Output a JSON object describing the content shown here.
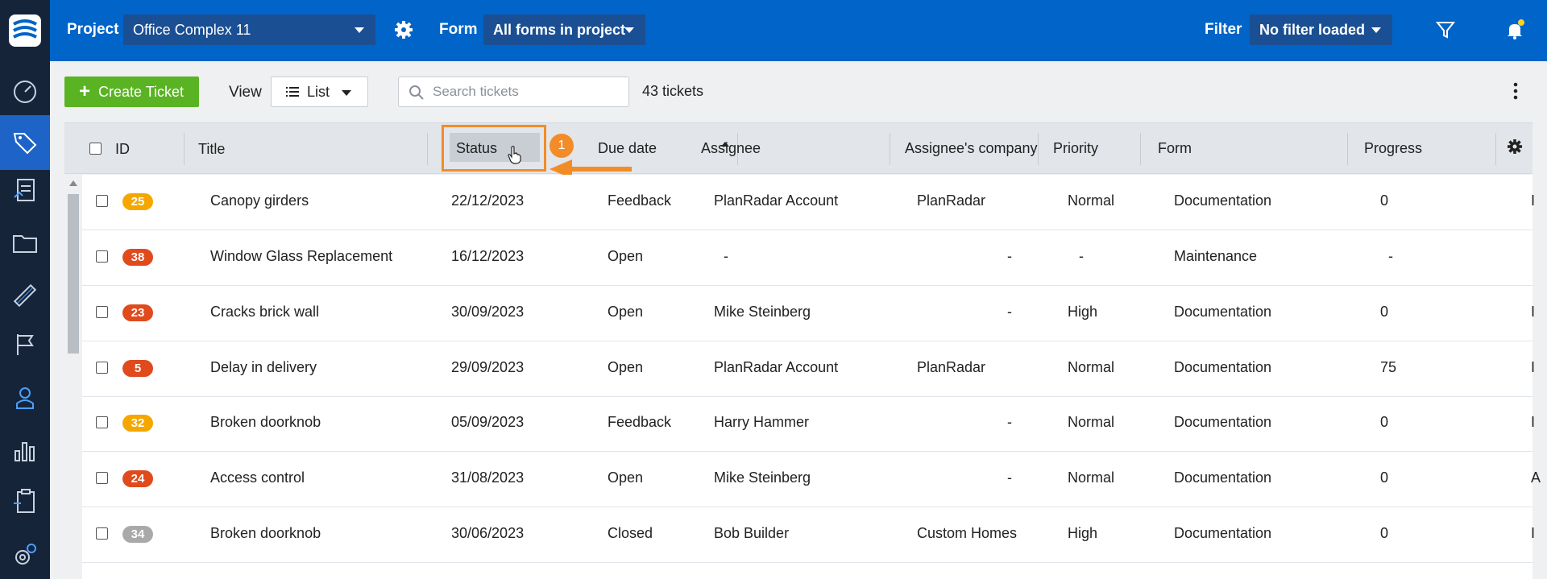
{
  "topbar": {
    "project_label": "Project",
    "project_value": "Office Complex 11",
    "form_label": "Form",
    "form_value": "All forms in project",
    "filter_label": "Filter",
    "filter_value": "No filter loaded"
  },
  "sidebar": {
    "items": [
      {
        "icon": "dashboard-icon"
      },
      {
        "icon": "tickets-icon",
        "active": true
      },
      {
        "icon": "forms-icon"
      },
      {
        "icon": "folder-icon"
      },
      {
        "icon": "plans-icon"
      },
      {
        "icon": "flag-icon"
      },
      {
        "icon": "user-icon"
      },
      {
        "icon": "reports-icon"
      },
      {
        "icon": "clipboard-icon"
      },
      {
        "icon": "settings-icon"
      }
    ]
  },
  "toolbar": {
    "create_label": "Create Ticket",
    "view_label": "View",
    "view_value": "List",
    "search_placeholder": "Search tickets",
    "ticket_count": "43 tickets"
  },
  "table": {
    "columns": [
      "ID",
      "Title",
      "Status",
      "Due date",
      "Assignee",
      "Assignee's company",
      "Priority",
      "Form",
      "Progress"
    ],
    "rows": [
      {
        "id": "25",
        "id_color": "#f5a700",
        "title": "Canopy girders",
        "due": "22/12/2023",
        "status": "Feedback",
        "assignee": "PlanRadar Account",
        "company": "PlanRadar",
        "priority": "Normal",
        "form": "Documentation",
        "progress": "0",
        "edge": "I"
      },
      {
        "id": "38",
        "id_color": "#e04a1c",
        "title": "Window Glass Replacement",
        "due": "16/12/2023",
        "status": "Open",
        "assignee": "-",
        "company": "-",
        "priority": "-",
        "form": "Maintenance",
        "progress": "-",
        "edge": ""
      },
      {
        "id": "23",
        "id_color": "#e04a1c",
        "title": "Cracks brick wall",
        "due": "30/09/2023",
        "status": "Open",
        "assignee": "Mike Steinberg",
        "company": "-",
        "priority": "High",
        "form": "Documentation",
        "progress": "0",
        "edge": "I"
      },
      {
        "id": "5",
        "id_color": "#e04a1c",
        "title": "Delay in delivery",
        "due": "29/09/2023",
        "status": "Open",
        "assignee": "PlanRadar Account",
        "company": "PlanRadar",
        "priority": "Normal",
        "form": "Documentation",
        "progress": "75",
        "edge": "I"
      },
      {
        "id": "32",
        "id_color": "#f5a700",
        "title": "Broken doorknob",
        "due": "05/09/2023",
        "status": "Feedback",
        "assignee": "Harry Hammer",
        "company": "-",
        "priority": "Normal",
        "form": "Documentation",
        "progress": "0",
        "edge": "I"
      },
      {
        "id": "24",
        "id_color": "#e04a1c",
        "title": "Access control",
        "due": "31/08/2023",
        "status": "Open",
        "assignee": "Mike Steinberg",
        "company": "-",
        "priority": "Normal",
        "form": "Documentation",
        "progress": "0",
        "edge": "A"
      },
      {
        "id": "34",
        "id_color": "#a9a9a9",
        "title": "Broken doorknob",
        "due": "30/06/2023",
        "status": "Closed",
        "assignee": "Bob Builder",
        "company": "Custom Homes",
        "priority": "High",
        "form": "Documentation",
        "progress": "0",
        "edge": "I"
      }
    ]
  },
  "annotation": {
    "step_number": "1",
    "color": "#f28c28"
  }
}
